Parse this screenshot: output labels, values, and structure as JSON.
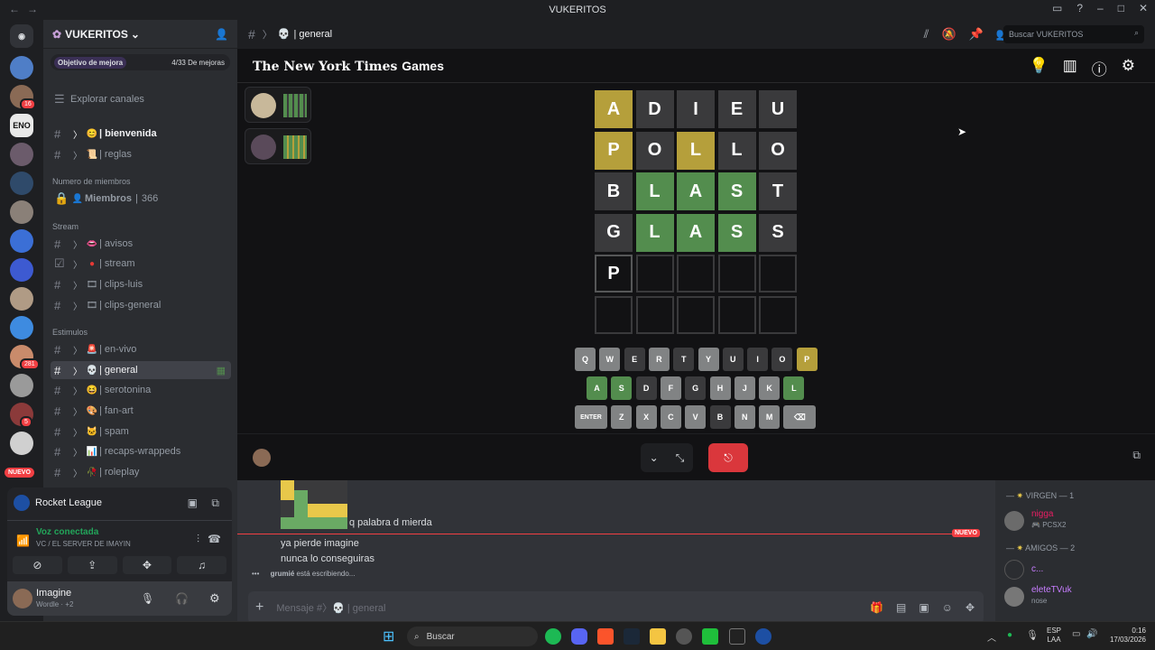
{
  "window": {
    "title": "VUKERITOS"
  },
  "server": {
    "name": "VUKERITOS",
    "boost_label": "Objetivo de mejora",
    "boost_progress": "4/33 De mejoras",
    "browse_label": "Explorar canales",
    "nuevo": "NUEVO"
  },
  "rail_badges": [
    "16",
    "281",
    "5"
  ],
  "channels": [
    {
      "name": "| bienvenida",
      "icon": "face-icon"
    },
    {
      "name": "| reglas",
      "icon": "scroll-icon"
    }
  ],
  "members_cat": "Numero de miembros",
  "members_row": {
    "label": "Miembros",
    "count": "366"
  },
  "cat_stream": "Stream",
  "stream_channels": [
    "| avisos",
    "| stream",
    "| clips-luis",
    "| clips-general"
  ],
  "cat_estimulos": "Estimulos",
  "estimulos_channels": [
    "| en-vivo",
    "| general",
    "| serotonina",
    "| fan-art",
    "| spam",
    "| recaps-wrappeds",
    "| roleplay"
  ],
  "rocket": {
    "title": "Rocket League"
  },
  "voice": {
    "status": "Voz conectada",
    "channel": "VC / EL SERVER DE IMAYIN"
  },
  "user": {
    "name": "Imagine",
    "status": "Wordle · +2"
  },
  "chat_header": {
    "channel": "| general",
    "search": "Buscar VUKERITOS"
  },
  "game": {
    "logo_a": "The New York Times",
    "logo_b": "Games",
    "board": [
      [
        [
          "A",
          "y"
        ],
        [
          "D",
          "x"
        ],
        [
          "I",
          "x"
        ],
        [
          "E",
          "x"
        ],
        [
          "U",
          "x"
        ]
      ],
      [
        [
          "P",
          "y"
        ],
        [
          "O",
          "x"
        ],
        [
          "L",
          "y"
        ],
        [
          "L",
          "x"
        ],
        [
          "O",
          "x"
        ]
      ],
      [
        [
          "B",
          "x"
        ],
        [
          "L",
          "g"
        ],
        [
          "A",
          "g"
        ],
        [
          "S",
          "g"
        ],
        [
          "T",
          "x"
        ]
      ],
      [
        [
          "G",
          "x"
        ],
        [
          "L",
          "g"
        ],
        [
          "A",
          "g"
        ],
        [
          "S",
          "g"
        ],
        [
          "S",
          "x"
        ]
      ],
      [
        [
          "P",
          "f"
        ],
        [
          "",
          "e"
        ],
        [
          "",
          "e"
        ],
        [
          "",
          "e"
        ],
        [
          "",
          "e"
        ]
      ],
      [
        [
          "",
          "e"
        ],
        [
          "",
          "e"
        ],
        [
          "",
          "e"
        ],
        [
          "",
          "e"
        ],
        [
          "",
          "e"
        ]
      ]
    ],
    "keyboard": [
      [
        [
          "Q",
          "u"
        ],
        [
          "W",
          "u"
        ],
        [
          "E",
          "x"
        ],
        [
          "R",
          "u"
        ],
        [
          "T",
          "x"
        ],
        [
          "Y",
          "u"
        ],
        [
          "U",
          "x"
        ],
        [
          "I",
          "x"
        ],
        [
          "O",
          "x"
        ],
        [
          "P",
          "y"
        ]
      ],
      [
        [
          "A",
          "g"
        ],
        [
          "S",
          "g"
        ],
        [
          "D",
          "x"
        ],
        [
          "F",
          "u"
        ],
        [
          "G",
          "x"
        ],
        [
          "H",
          "u"
        ],
        [
          "J",
          "u"
        ],
        [
          "K",
          "u"
        ],
        [
          "L",
          "g"
        ]
      ],
      [
        [
          "ENTER",
          "u"
        ],
        [
          "Z",
          "u"
        ],
        [
          "X",
          "u"
        ],
        [
          "C",
          "u"
        ],
        [
          "V",
          "u"
        ],
        [
          "B",
          "x"
        ],
        [
          "N",
          "u"
        ],
        [
          "M",
          "u"
        ],
        [
          "⌫",
          "u"
        ]
      ]
    ]
  },
  "messages": {
    "m1": "q palabra d mierda",
    "new_label": "NUEVO",
    "m2": "ya pierde imagine",
    "m3": "nunca lo conseguiras",
    "typing_user": "grumié",
    "typing_text": "está escribiendo...",
    "placeholder": "Mensaje #〉💀 | general"
  },
  "memberlist": {
    "group1": "VIRGEN — 1",
    "member1": {
      "name": "nigga",
      "sub": "PCSX2"
    },
    "group2": "AMIGOS — 2",
    "member2": {
      "name": "c..."
    },
    "member3": {
      "name": "eleteTVuk",
      "sub": "nose"
    }
  },
  "taskbar": {
    "search": "Buscar",
    "lang1": "ESP",
    "lang2": "LAA",
    "time": "0:16",
    "date": "17/03/2026"
  },
  "colors": {
    "wordle_yellow": "#b59f3b",
    "wordle_green": "#538d4e",
    "discord_red": "#f23f43",
    "voice_green": "#23a55a"
  }
}
